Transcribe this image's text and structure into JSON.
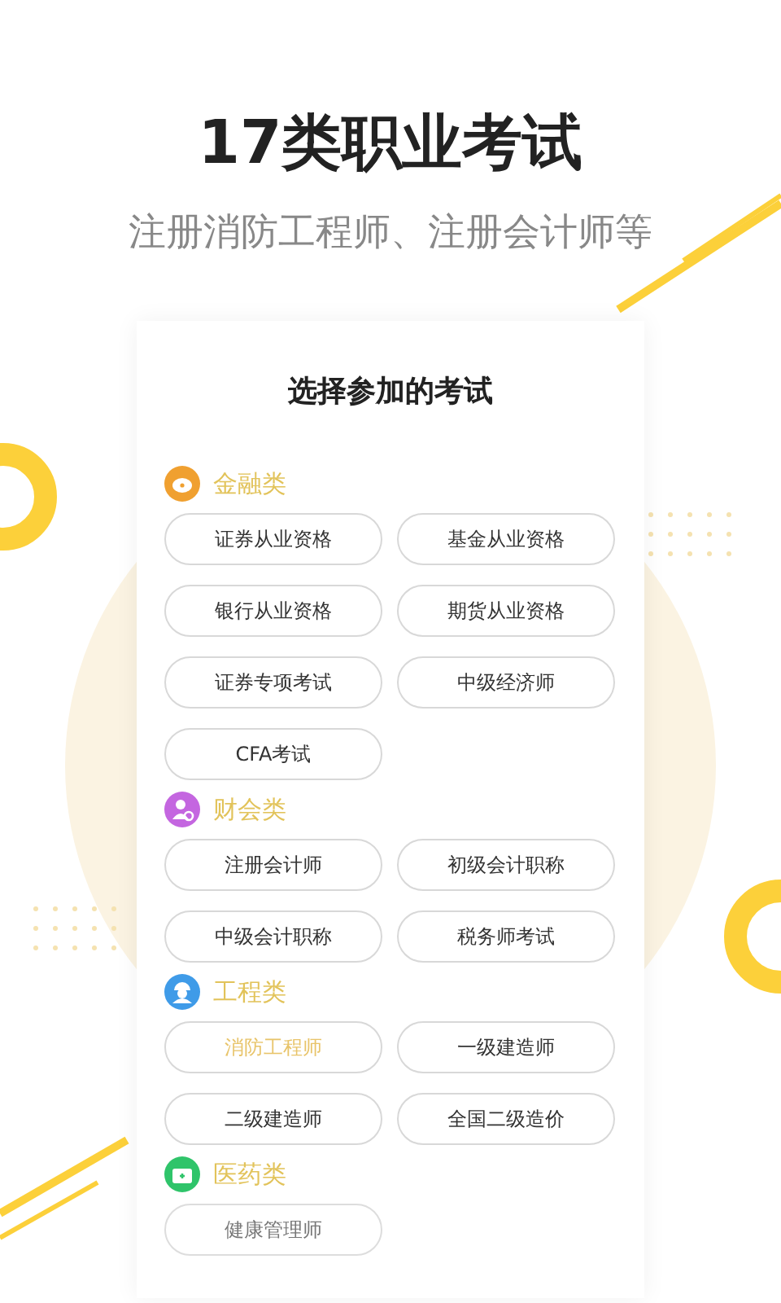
{
  "headline": "17类职业考试",
  "subtitle": "注册消防工程师、注册会计师等",
  "card": {
    "title": "选择参加的考试",
    "categories": [
      {
        "name": "金融类",
        "kind": "finance",
        "color": "#f0a030",
        "exams": [
          {
            "label": "证券从业资格",
            "selected": false
          },
          {
            "label": "基金从业资格",
            "selected": false
          },
          {
            "label": "银行从业资格",
            "selected": false
          },
          {
            "label": "期货从业资格",
            "selected": false
          },
          {
            "label": "证券专项考试",
            "selected": false
          },
          {
            "label": "中级经济师",
            "selected": false
          },
          {
            "label": "CFA考试",
            "selected": false
          }
        ]
      },
      {
        "name": "财会类",
        "kind": "accounting",
        "color": "#c466e0",
        "exams": [
          {
            "label": "注册会计师",
            "selected": false
          },
          {
            "label": "初级会计职称",
            "selected": false
          },
          {
            "label": "中级会计职称",
            "selected": false
          },
          {
            "label": "税务师考试",
            "selected": false
          }
        ]
      },
      {
        "name": "工程类",
        "kind": "engineering",
        "color": "#3f9be8",
        "exams": [
          {
            "label": "消防工程师",
            "selected": true
          },
          {
            "label": "一级建造师",
            "selected": false
          },
          {
            "label": "二级建造师",
            "selected": false
          },
          {
            "label": "全国二级造价",
            "selected": false
          }
        ]
      },
      {
        "name": "医药类",
        "kind": "medicine",
        "color": "#2fc46a",
        "exams": [
          {
            "label": "健康管理师",
            "selected": false
          }
        ]
      }
    ]
  }
}
